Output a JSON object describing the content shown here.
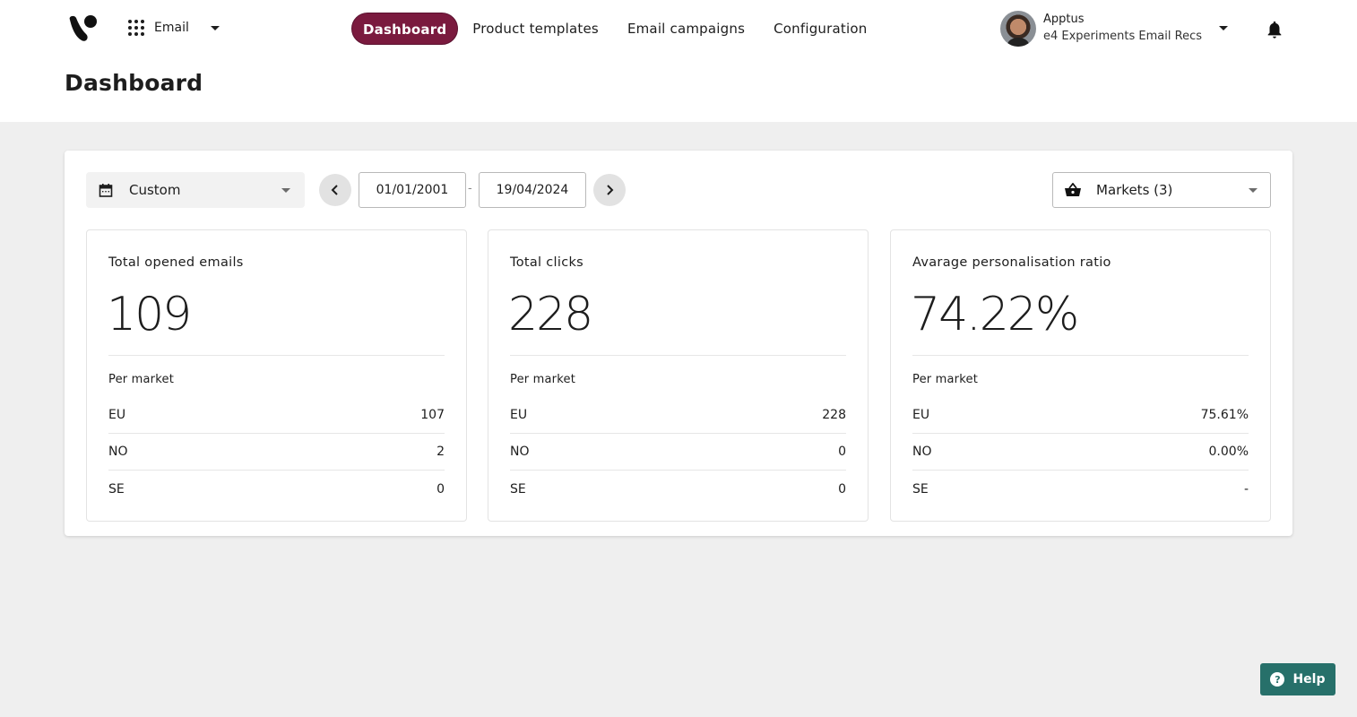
{
  "header": {
    "app_switcher": {
      "label": "Email",
      "icon": "apps-grid-icon"
    },
    "nav": [
      {
        "label": "Dashboard",
        "active": true
      },
      {
        "label": "Product templates",
        "active": false
      },
      {
        "label": "Email campaigns",
        "active": false
      },
      {
        "label": "Configuration",
        "active": false
      }
    ],
    "account": {
      "name": "Apptus",
      "subtitle": "e4 Experiments Email Recs"
    },
    "notifications_icon": "bell-icon"
  },
  "page": {
    "title": "Dashboard"
  },
  "filters": {
    "range": {
      "label": "Custom",
      "icon": "calendar-icon"
    },
    "date_from": "01/01/2001",
    "date_to": "19/04/2024",
    "separator": "-",
    "markets": {
      "label": "Markets (3)",
      "icon": "basket-icon"
    }
  },
  "cards": [
    {
      "title": "Total opened emails",
      "value": "109",
      "per_market_label": "Per market",
      "rows": [
        {
          "market": "EU",
          "value": "107"
        },
        {
          "market": "NO",
          "value": "2"
        },
        {
          "market": "SE",
          "value": "0"
        }
      ]
    },
    {
      "title": "Total clicks",
      "value": "228",
      "per_market_label": "Per market",
      "rows": [
        {
          "market": "EU",
          "value": "228"
        },
        {
          "market": "NO",
          "value": "0"
        },
        {
          "market": "SE",
          "value": "0"
        }
      ]
    },
    {
      "title": "Avarage personalisation ratio",
      "value": "74.22%",
      "per_market_label": "Per market",
      "rows": [
        {
          "market": "EU",
          "value": "75.61%"
        },
        {
          "market": "NO",
          "value": "0.00%"
        },
        {
          "market": "SE",
          "value": "-"
        }
      ]
    }
  ],
  "help": {
    "label": "Help",
    "icon": "question-icon",
    "icon_glyph": "?"
  },
  "colors": {
    "accent": "#7a1a3e",
    "help": "#27706a",
    "background": "#efefef"
  }
}
